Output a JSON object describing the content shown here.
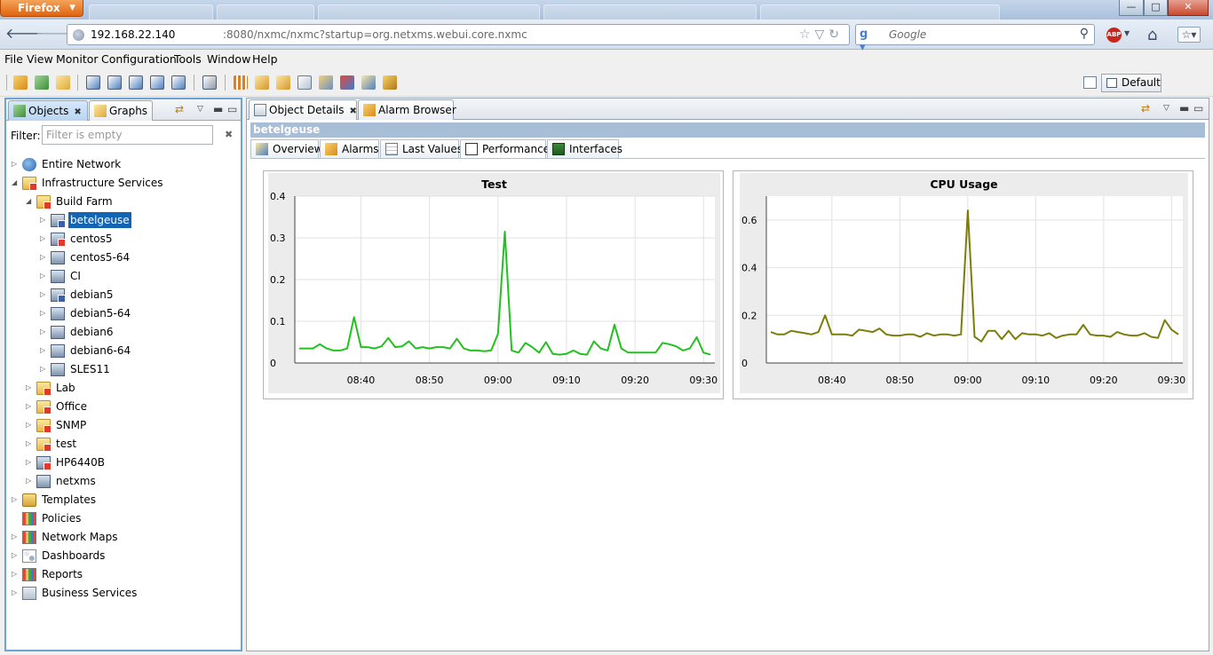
{
  "browser": {
    "button_label": "Firefox",
    "url_host": "192.168.22.140",
    "url_rest": ":8080/nxmc/nxmc?startup=org.netxms.webui.core.nxmc",
    "search_placeholder": "Google",
    "win_minimize": "—",
    "win_maximize": "□",
    "win_close": "✕"
  },
  "menu": [
    "File",
    "View",
    "Monitor",
    "Configuration",
    "Tools",
    "Window",
    "Help"
  ],
  "toolbar": {
    "perspective_label": "Default"
  },
  "objects_view": {
    "tabs": [
      {
        "label": "Objects",
        "close": "✖"
      },
      {
        "label": "Graphs"
      }
    ],
    "filter_label": "Filter:",
    "filter_placeholder": "Filter is empty",
    "filter_clear": "✖",
    "tree": [
      {
        "label": "Entire Network"
      },
      {
        "label": "Infrastructure Services"
      },
      {
        "label": "Build Farm"
      },
      {
        "label": "betelgeuse"
      },
      {
        "label": "centos5"
      },
      {
        "label": "centos5-64"
      },
      {
        "label": "CI"
      },
      {
        "label": "debian5"
      },
      {
        "label": "debian5-64"
      },
      {
        "label": "debian6"
      },
      {
        "label": "debian6-64"
      },
      {
        "label": "SLES11"
      },
      {
        "label": "Lab"
      },
      {
        "label": "Office"
      },
      {
        "label": "SNMP"
      },
      {
        "label": "test"
      },
      {
        "label": "HP6440B"
      },
      {
        "label": "netxms"
      },
      {
        "label": "Templates"
      },
      {
        "label": "Policies"
      },
      {
        "label": "Network Maps"
      },
      {
        "label": "Dashboards"
      },
      {
        "label": "Reports"
      },
      {
        "label": "Business Services"
      }
    ]
  },
  "details_view": {
    "tabs": [
      {
        "label": "Object Details",
        "close": "✖"
      },
      {
        "label": "Alarm Browser"
      }
    ],
    "object_name": "betelgeuse",
    "subtabs": [
      "Overview",
      "Alarms",
      "Last Values",
      "Performance",
      "Interfaces"
    ]
  },
  "chart_data": [
    {
      "type": "line",
      "title": "Test",
      "color": "#22c21e",
      "ylim": [
        0,
        0.4
      ],
      "yticks": [
        "0",
        "0.1",
        "0.2",
        "0.3",
        "0.4"
      ],
      "xticks": [
        "08:40",
        "08:50",
        "09:00",
        "09:10",
        "09:20",
        "09:30"
      ],
      "x": [
        "08:31",
        "08:32",
        "08:33",
        "08:34",
        "08:35",
        "08:36",
        "08:37",
        "08:38",
        "08:39",
        "08:40",
        "08:41",
        "08:42",
        "08:43",
        "08:44",
        "08:45",
        "08:46",
        "08:47",
        "08:48",
        "08:49",
        "08:50",
        "08:51",
        "08:52",
        "08:53",
        "08:54",
        "08:55",
        "08:56",
        "08:57",
        "08:58",
        "08:59",
        "09:00",
        "09:01",
        "09:02",
        "09:03",
        "09:04",
        "09:05",
        "09:06",
        "09:07",
        "09:08",
        "09:09",
        "09:10",
        "09:11",
        "09:12",
        "09:13",
        "09:14",
        "09:15",
        "09:16",
        "09:17",
        "09:18",
        "09:19",
        "09:20",
        "09:21",
        "09:22",
        "09:23",
        "09:24",
        "09:25",
        "09:26",
        "09:27",
        "09:28",
        "09:29",
        "09:30",
        "09:31"
      ],
      "values": [
        0.035,
        0.035,
        0.035,
        0.045,
        0.035,
        0.03,
        0.03,
        0.035,
        0.11,
        0.038,
        0.038,
        0.035,
        0.04,
        0.06,
        0.038,
        0.04,
        0.052,
        0.035,
        0.038,
        0.035,
        0.038,
        0.038,
        0.035,
        0.058,
        0.035,
        0.03,
        0.03,
        0.028,
        0.03,
        0.07,
        0.315,
        0.03,
        0.025,
        0.048,
        0.038,
        0.025,
        0.05,
        0.022,
        0.02,
        0.022,
        0.03,
        0.022,
        0.02,
        0.052,
        0.035,
        0.03,
        0.092,
        0.035,
        0.025,
        0.025,
        0.025,
        0.025,
        0.025,
        0.048,
        0.045,
        0.04,
        0.03,
        0.035,
        0.062,
        0.025,
        0.02
      ]
    },
    {
      "type": "line",
      "title": "CPU Usage",
      "color": "#7c7c0c",
      "ylim": [
        0,
        0.7
      ],
      "yticks": [
        "0",
        "0.2",
        "0.4",
        "0.6"
      ],
      "xticks": [
        "08:40",
        "08:50",
        "09:00",
        "09:10",
        "09:20",
        "09:30"
      ],
      "x": [
        "08:31",
        "08:32",
        "08:33",
        "08:34",
        "08:35",
        "08:36",
        "08:37",
        "08:38",
        "08:39",
        "08:40",
        "08:41",
        "08:42",
        "08:43",
        "08:44",
        "08:45",
        "08:46",
        "08:47",
        "08:48",
        "08:49",
        "08:50",
        "08:51",
        "08:52",
        "08:53",
        "08:54",
        "08:55",
        "08:56",
        "08:57",
        "08:58",
        "08:59",
        "09:00",
        "09:01",
        "09:02",
        "09:03",
        "09:04",
        "09:05",
        "09:06",
        "09:07",
        "09:08",
        "09:09",
        "09:10",
        "09:11",
        "09:12",
        "09:13",
        "09:14",
        "09:15",
        "09:16",
        "09:17",
        "09:18",
        "09:19",
        "09:20",
        "09:21",
        "09:22",
        "09:23",
        "09:24",
        "09:25",
        "09:26",
        "09:27",
        "09:28",
        "09:29",
        "09:30",
        "09:31"
      ],
      "values": [
        0.13,
        0.12,
        0.12,
        0.135,
        0.13,
        0.125,
        0.12,
        0.13,
        0.2,
        0.12,
        0.12,
        0.12,
        0.115,
        0.14,
        0.135,
        0.13,
        0.145,
        0.12,
        0.115,
        0.115,
        0.12,
        0.12,
        0.11,
        0.125,
        0.115,
        0.12,
        0.12,
        0.115,
        0.12,
        0.64,
        0.11,
        0.09,
        0.135,
        0.135,
        0.1,
        0.135,
        0.1,
        0.125,
        0.12,
        0.12,
        0.115,
        0.125,
        0.105,
        0.115,
        0.12,
        0.12,
        0.16,
        0.12,
        0.115,
        0.115,
        0.11,
        0.13,
        0.12,
        0.115,
        0.115,
        0.125,
        0.11,
        0.105,
        0.18,
        0.14,
        0.12
      ]
    }
  ]
}
